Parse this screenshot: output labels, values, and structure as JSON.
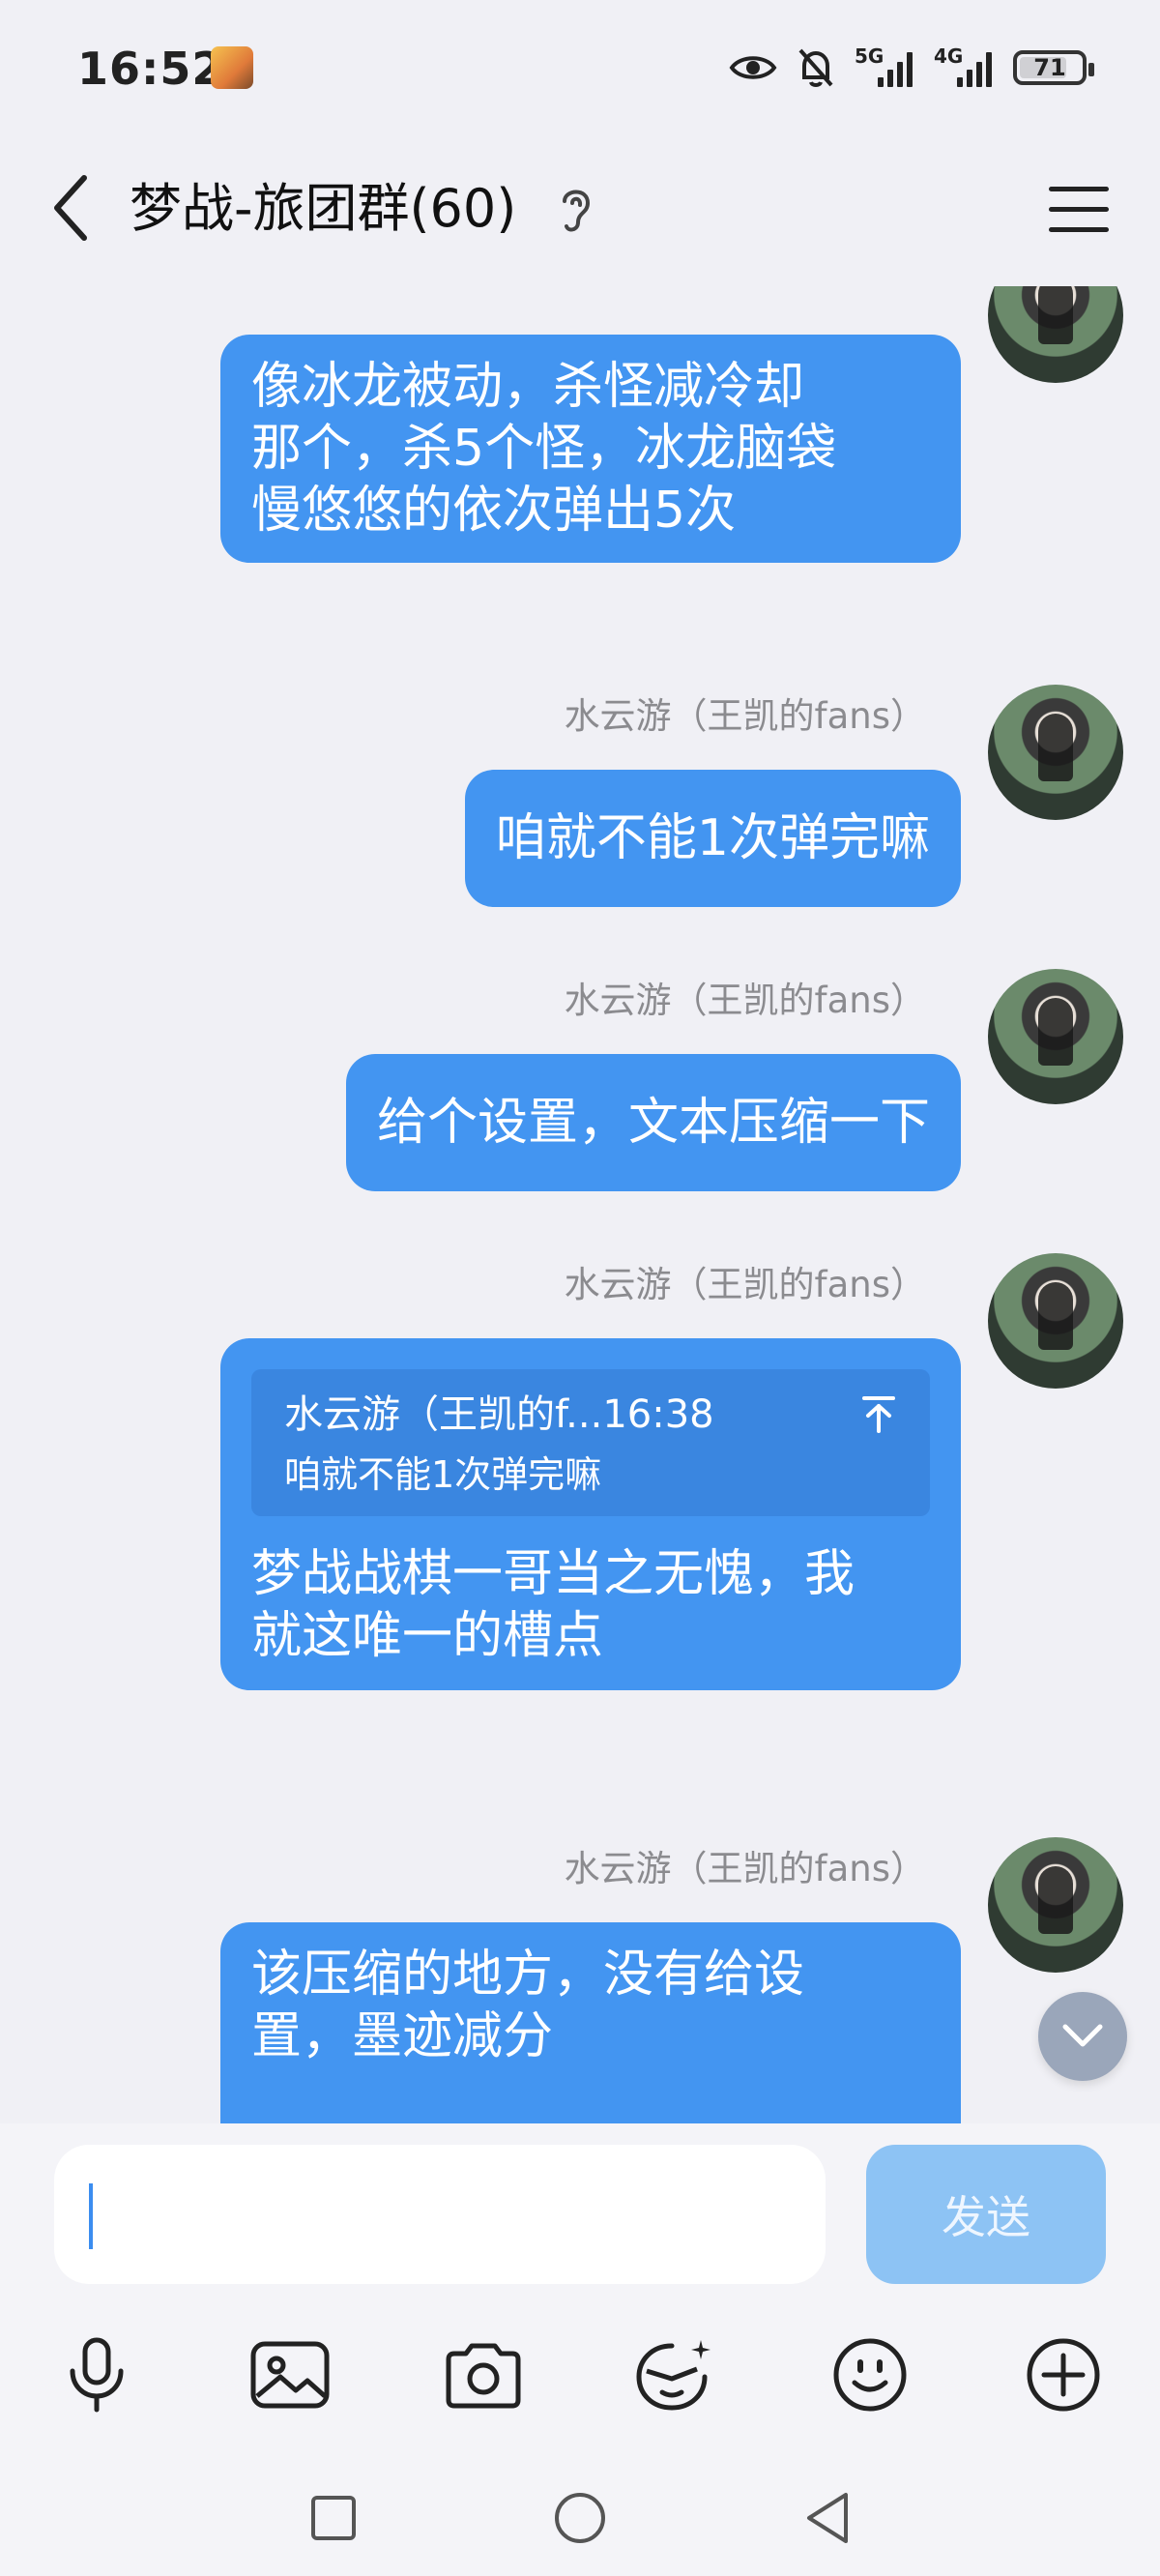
{
  "status_bar": {
    "time": "16:52",
    "network1": "5G",
    "network2": "4G",
    "battery": "71"
  },
  "header": {
    "title": "梦战-旅团群(60)"
  },
  "messages": [
    {
      "sender": "水云游（王凯的fans）",
      "text": "像冰龙被动，杀怪减冷却那个，杀5个怪，冰龙脑袋慢悠悠的依次弹出5次",
      "lines": [
        "像冰龙被动，杀怪减冷却",
        "那个，杀5个怪，冰龙脑袋",
        "慢悠悠的依次弹出5次"
      ]
    },
    {
      "sender": "水云游（王凯的fans）",
      "text": "咱就不能1次弹完嘛"
    },
    {
      "sender": "水云游（王凯的fans）",
      "text": "给个设置，文本压缩一下"
    },
    {
      "sender": "水云游（王凯的fans）",
      "quote": {
        "head": "水云游（王凯的f...16:38",
        "body": "咱就不能1次弹完嘛"
      },
      "lines": [
        "梦战战棋一哥当之无愧，我",
        "就这唯一的槽点"
      ]
    },
    {
      "sender": "水云游（王凯的fans）",
      "lines": [
        "该压缩的地方，没有给设",
        "置，墨迹减分"
      ]
    }
  ],
  "input": {
    "value": "",
    "send_label": "发送"
  },
  "toolbar": [
    "microphone-icon",
    "image-icon",
    "camera-icon",
    "sticker-icon",
    "emoji-icon",
    "plus-icon"
  ],
  "colors": {
    "bubble": "#4395f1",
    "background": "#f0f0f5",
    "send_disabled": "#8dc3f4"
  }
}
